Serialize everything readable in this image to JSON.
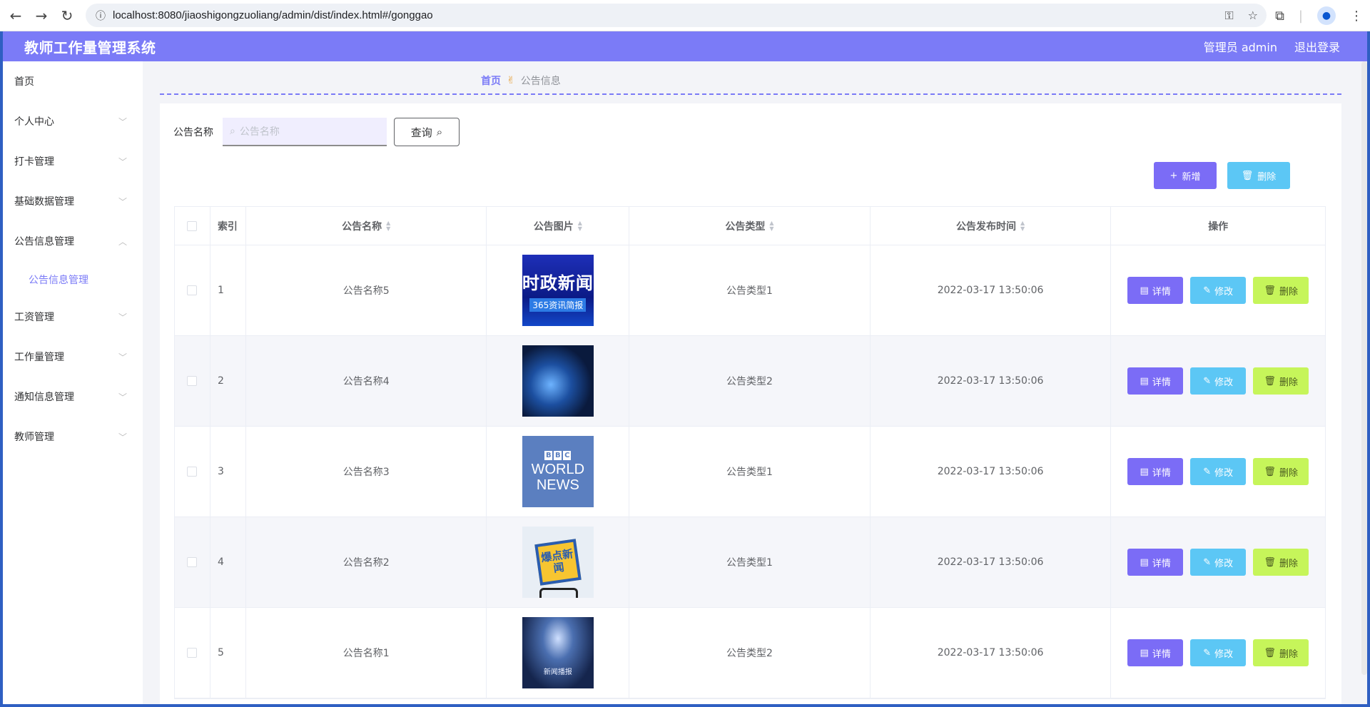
{
  "browser": {
    "url": "localhost:8080/jiaoshigongzuoliang/admin/dist/index.html#/gonggao"
  },
  "header": {
    "title": "教师工作量管理系统",
    "user": "管理员 admin",
    "logout": "退出登录"
  },
  "sidebar": {
    "items": [
      {
        "label": "首页"
      },
      {
        "label": "个人中心"
      },
      {
        "label": "打卡管理"
      },
      {
        "label": "基础数据管理"
      },
      {
        "label": "公告信息管理"
      },
      {
        "label": "公告信息管理"
      },
      {
        "label": "工资管理"
      },
      {
        "label": "工作量管理"
      },
      {
        "label": "通知信息管理"
      },
      {
        "label": "教师管理"
      }
    ]
  },
  "breadcrumb": {
    "home": "首页",
    "current": "公告信息"
  },
  "search": {
    "label": "公告名称",
    "placeholder": "公告名称",
    "button": "查询"
  },
  "toolbar": {
    "add": "新增",
    "delete": "删除"
  },
  "table": {
    "headers": {
      "index": "索引",
      "name": "公告名称",
      "image": "公告图片",
      "type": "公告类型",
      "time": "公告发布时间",
      "ops": "操作"
    },
    "rows": [
      {
        "index": "1",
        "name": "公告名称5",
        "image_text": "时政新闻",
        "image_sub": "365资讯简报",
        "type": "公告类型1",
        "time": "2022-03-17 13:50:06"
      },
      {
        "index": "2",
        "name": "公告名称4",
        "type": "公告类型2",
        "time": "2022-03-17 13:50:06"
      },
      {
        "index": "3",
        "name": "公告名称3",
        "image_text": "WORLD",
        "image_sub": "NEWS",
        "type": "公告类型1",
        "time": "2022-03-17 13:50:06"
      },
      {
        "index": "4",
        "name": "公告名称2",
        "image_text": "爆点新闻",
        "type": "公告类型1",
        "time": "2022-03-17 13:50:06"
      },
      {
        "index": "5",
        "name": "公告名称1",
        "image_text": "新闻播报",
        "type": "公告类型2",
        "time": "2022-03-17 13:50:06"
      }
    ],
    "ops": {
      "detail": "详情",
      "edit": "修改",
      "delete": "删除"
    }
  }
}
